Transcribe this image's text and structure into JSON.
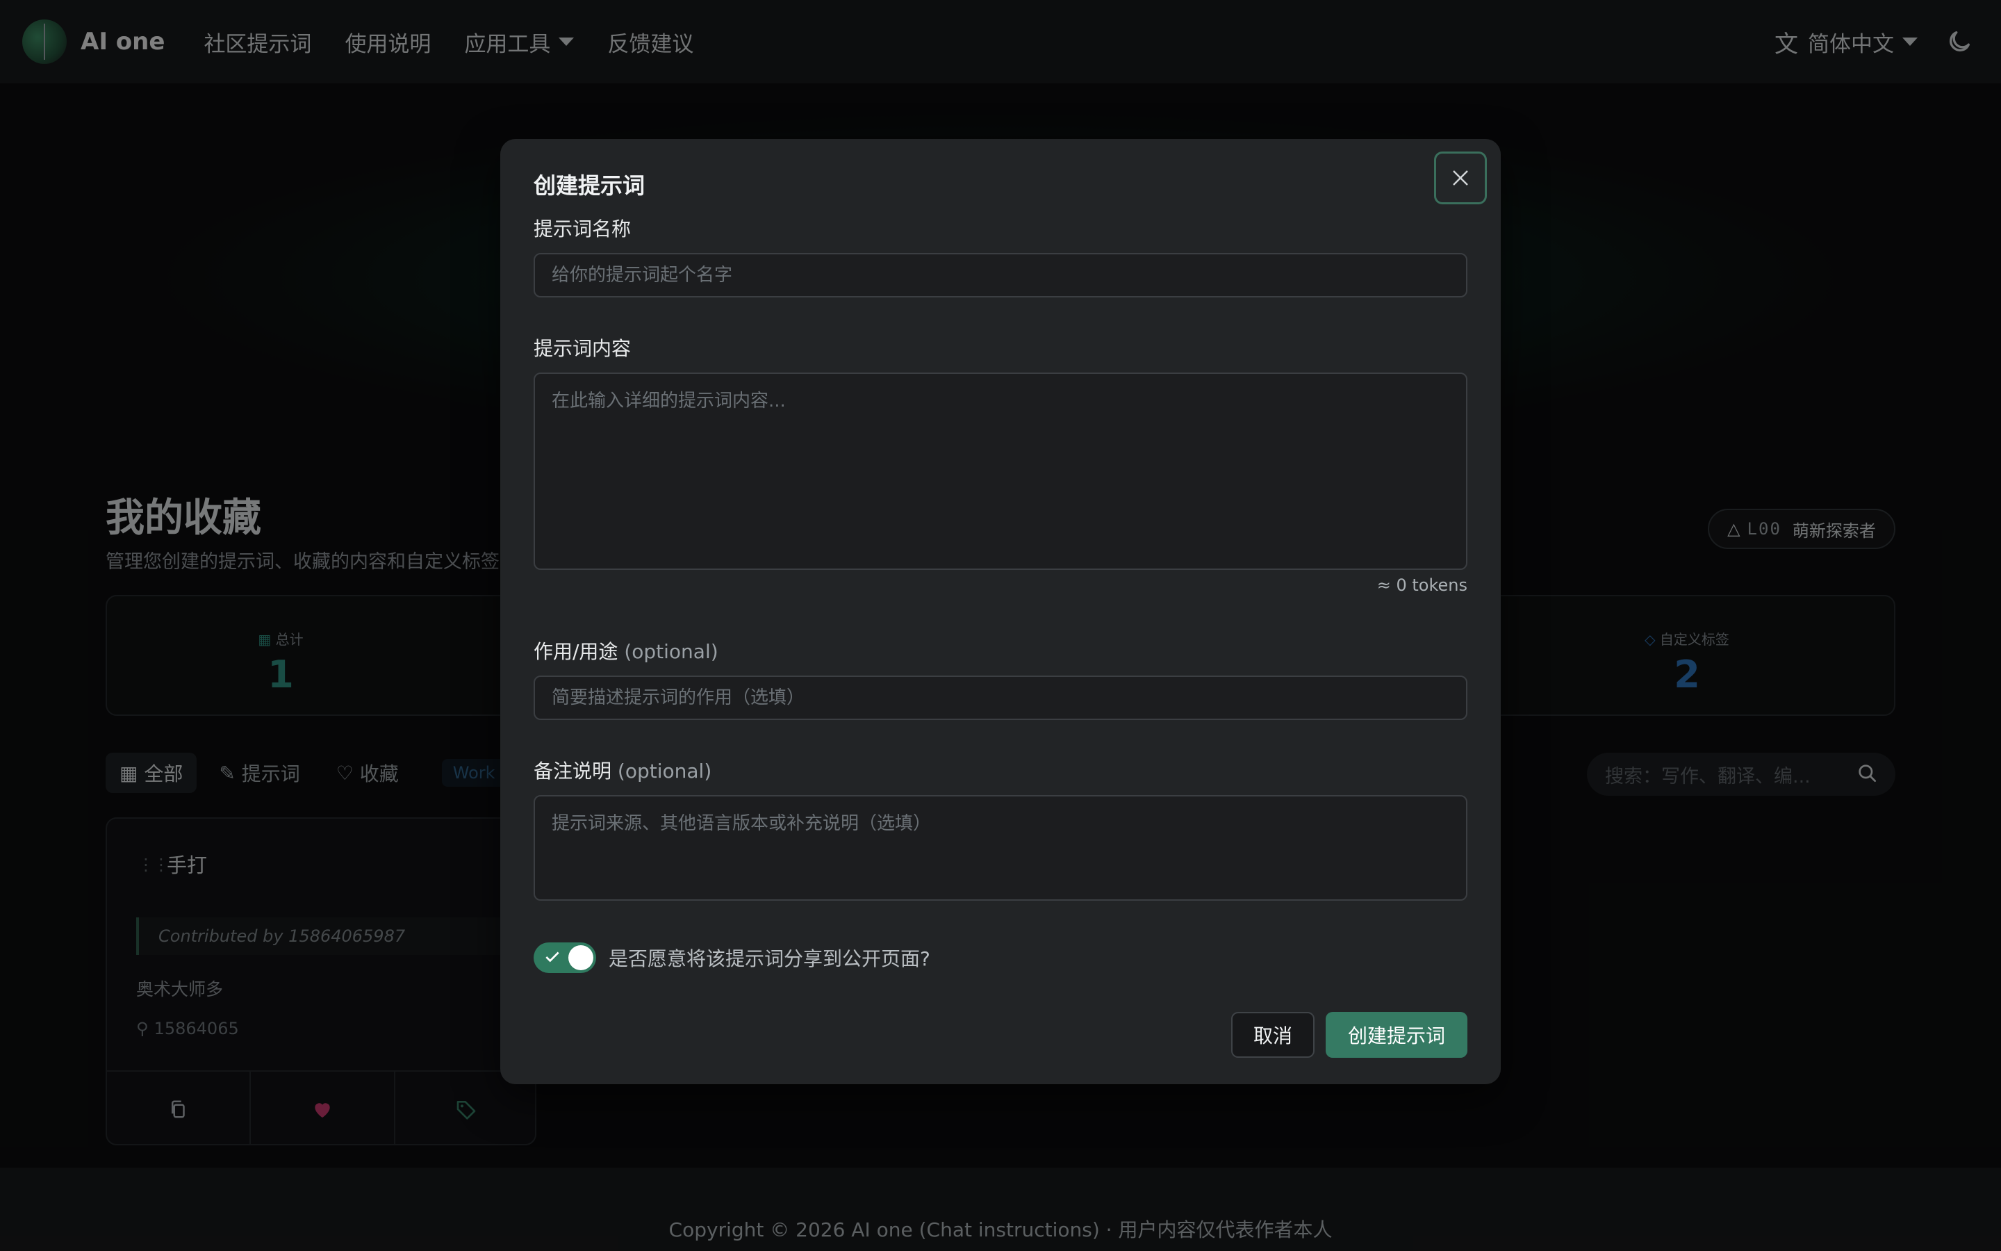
{
  "header": {
    "brand": "AI one",
    "nav": [
      {
        "label": "社区提示词"
      },
      {
        "label": "使用说明"
      },
      {
        "label": "应用工具"
      },
      {
        "label": "反馈建议"
      }
    ],
    "language": "简体中文"
  },
  "page": {
    "title": "我的收藏",
    "subtitle": "管理您创建的提示词、收藏的内容和自定义标签",
    "level_code": "L00",
    "level_name": "萌新探索者",
    "stats": {
      "total_label": "总计",
      "total_value": "1",
      "tags_label": "自定义标签",
      "tags_value": "2"
    },
    "filters": [
      {
        "label": "全部"
      },
      {
        "label": "提示词"
      },
      {
        "label": "收藏"
      }
    ],
    "tag_chip": "Work",
    "search_placeholder": "搜索：写作、翻译、编..."
  },
  "card": {
    "title": "手打",
    "contributed": "Contributed by 15864065987",
    "description": "奥术大师多",
    "user": "15864065"
  },
  "modal": {
    "title": "创建提示词",
    "name_label": "提示词名称",
    "name_placeholder": "给你的提示词起个名字",
    "content_label": "提示词内容",
    "content_placeholder": "在此输入详细的提示词内容...",
    "tokens": "≈ 0 tokens",
    "purpose_label": "作用/用途",
    "purpose_optional": "(optional)",
    "purpose_placeholder": "简要描述提示词的作用（选填）",
    "notes_label": "备注说明",
    "notes_optional": "(optional)",
    "notes_placeholder": "提示词来源、其他语言版本或补充说明（选填）",
    "share_label": "是否愿意将该提示词分享到公开页面?",
    "share_enabled": true,
    "cancel_label": "取消",
    "submit_label": "创建提示词"
  },
  "footer": {
    "text": "Copyright © 2026 AI one (Chat instructions) · 用户内容仅代表作者本人"
  },
  "colors": {
    "accent": "#357a63",
    "stat_total": "#2e8a7c",
    "stat_tags": "#2d6fb3",
    "heart": "#c0386b"
  }
}
